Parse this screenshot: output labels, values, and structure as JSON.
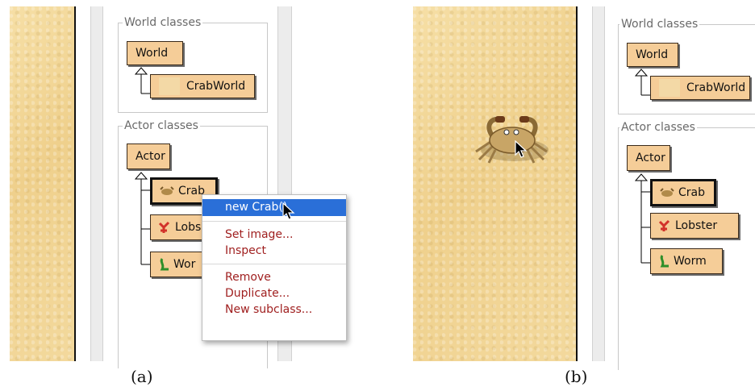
{
  "panel_a": {
    "world_legend": "World classes",
    "world_class": "World",
    "world_subclass": "CrabWorld",
    "actor_legend": "Actor classes",
    "actor_class": "Actor",
    "actor_subclasses": [
      "Crab",
      "Lobs",
      "Wor"
    ],
    "context_menu": {
      "highlighted": "new Crab()",
      "items": [
        "Set image...",
        "Inspect",
        "Remove",
        "Duplicate...",
        "New subclass..."
      ]
    },
    "caption": "(a)"
  },
  "panel_b": {
    "world_legend": "World classes",
    "world_class": "World",
    "world_subclass": "CrabWorld",
    "actor_legend": "Actor classes",
    "actor_class": "Actor",
    "actor_subclasses": [
      "Crab",
      "Lobster",
      "Worm"
    ],
    "caption": "(b)"
  },
  "colors": {
    "sand": "#f1d596",
    "class_box": "#f5cd98",
    "menu_highlight": "#2a6fd8",
    "menu_text": "#a02020"
  },
  "icons": [
    "crab-icon",
    "lobster-icon",
    "worm-icon",
    "pointer-cursor-icon",
    "inheritance-arrow-icon"
  ]
}
